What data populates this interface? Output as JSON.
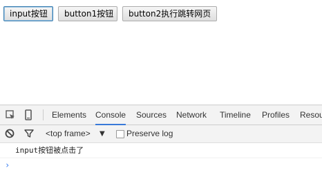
{
  "page": {
    "buttons": [
      {
        "label": "input按钮"
      },
      {
        "label": "button1按钮"
      },
      {
        "label": "button2执行跳转网页"
      }
    ]
  },
  "devtools": {
    "tabs": [
      {
        "label": "Elements"
      },
      {
        "label": "Console"
      },
      {
        "label": "Sources"
      },
      {
        "label": "Network"
      },
      {
        "label": "Timeline"
      },
      {
        "label": "Profiles"
      },
      {
        "label": "Resou"
      }
    ],
    "active_tab": "Console",
    "toolbar": {
      "frame": "<top frame>",
      "frame_arrow": "▼",
      "preserve_log_label": "Preserve log",
      "preserve_log_checked": false
    },
    "console": {
      "messages": [
        {
          "text": "input按钮被点击了"
        }
      ],
      "prompt_symbol": "›"
    },
    "colors": {
      "accent": "#3879d9",
      "prompt": "#367cf1",
      "tabbar_bg": "#f3f3f3"
    },
    "icons": [
      "inspect-element-icon",
      "device-mode-icon",
      "clear-console-icon",
      "filter-icon"
    ]
  }
}
